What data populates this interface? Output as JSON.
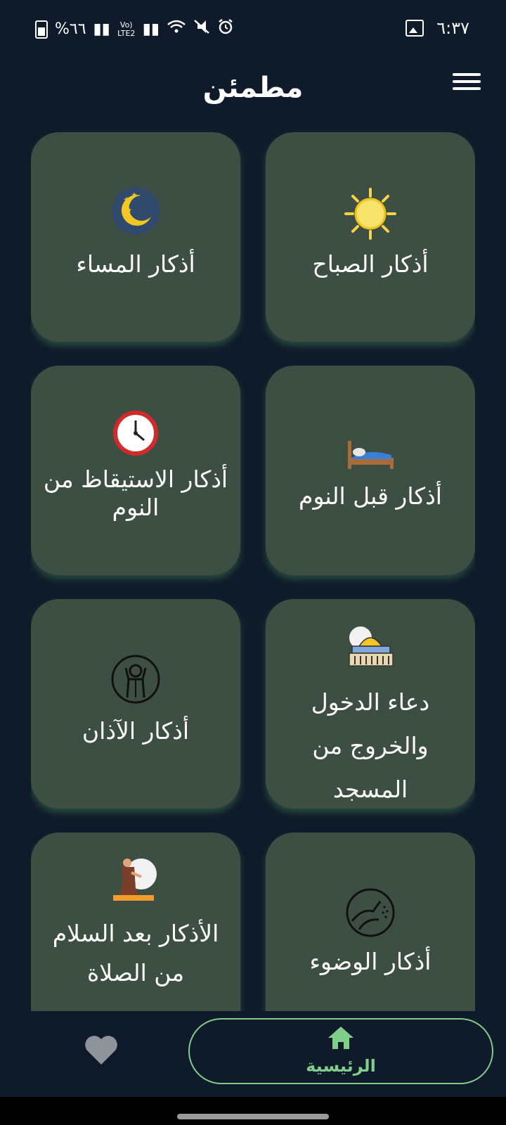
{
  "status_bar": {
    "time": "٦:٣٧",
    "battery_text": "%٦٦",
    "network_label": "Vo) LTE2"
  },
  "header": {
    "title": "مطمئن"
  },
  "cards": [
    {
      "label": "أذكار الصباح",
      "icon": "sun-icon"
    },
    {
      "label": "أذكار المساء",
      "icon": "moon-icon"
    },
    {
      "label": "أذكار قبل النوم",
      "icon": "bed-icon"
    },
    {
      "label": "أذكار الاستيقاظ من النوم",
      "icon": "alarm-clock-icon"
    },
    {
      "label": "دعاء الدخول والخروج من المسجد",
      "icon": "mosque-icon"
    },
    {
      "label": "أذكار الآذان",
      "icon": "muezzin-icon"
    },
    {
      "label": "أذكار الوضوء",
      "icon": "ablution-icon"
    },
    {
      "label": "الأذكار بعد السلام من الصلاة",
      "icon": "praying-man-icon"
    }
  ],
  "bottom_nav": {
    "home_label": "الرئيسية",
    "favorites_icon": "heart-icon",
    "home_icon": "home-icon"
  },
  "colors": {
    "background": "#0f1b2a",
    "card": "#3d4e42",
    "accent": "#7fce8a"
  }
}
